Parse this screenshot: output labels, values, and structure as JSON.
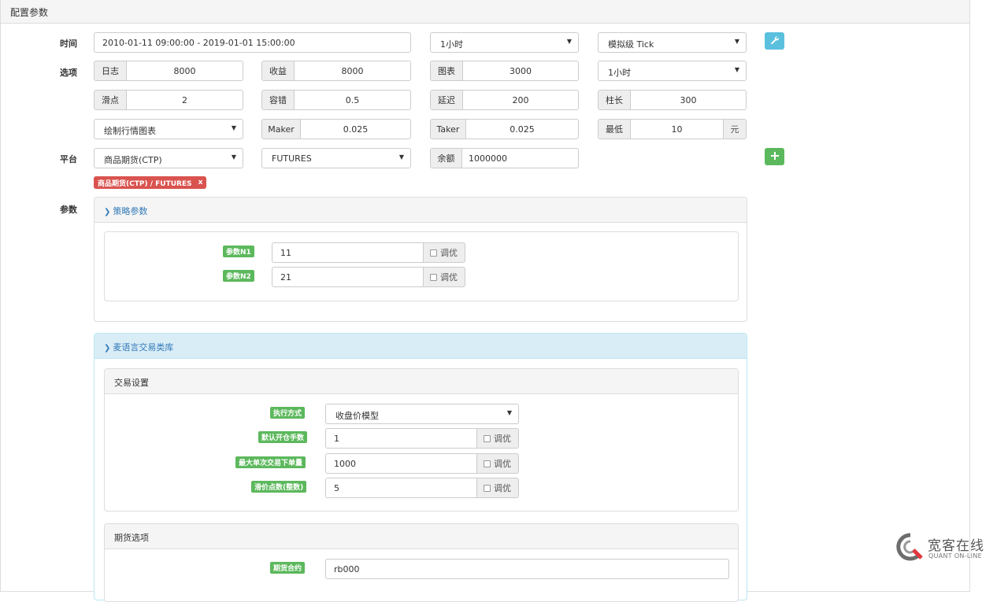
{
  "header": {
    "title": "配置参数"
  },
  "labels": {
    "time": "时间",
    "options": "选项",
    "platform": "平台",
    "params": "参数"
  },
  "time": {
    "range": "2010-01-11 09:00:00 - 2019-01-01 15:00:00",
    "period": "1小时",
    "tick_mode": "模拟级 Tick"
  },
  "options_row1": [
    {
      "label": "日志",
      "value": "8000"
    },
    {
      "label": "收益",
      "value": "8000"
    },
    {
      "label": "图表",
      "value": "3000"
    }
  ],
  "options_row1_select": "1小时",
  "options_row2": [
    {
      "label": "滑点",
      "value": "2"
    },
    {
      "label": "容错",
      "value": "0.5"
    },
    {
      "label": "延迟",
      "value": "200"
    },
    {
      "label": "柱长",
      "value": "300"
    }
  ],
  "options_row3": {
    "chart_select": "绘制行情图表",
    "maker_label": "Maker",
    "maker_value": "0.025",
    "taker_label": "Taker",
    "taker_value": "0.025",
    "min_label": "最低",
    "min_value": "10",
    "min_unit": "元"
  },
  "platform": {
    "exchange": "商品期货(CTP)",
    "type": "FUTURES",
    "balance_label": "余额",
    "balance_value": "1000000",
    "tag": "商品期货(CTP) / FUTURES",
    "tag_close": "x"
  },
  "strategy_panel": {
    "title": "策略参数",
    "params": [
      {
        "label": "参数N1",
        "value": "11",
        "tune": "调优"
      },
      {
        "label": "参数N2",
        "value": "21",
        "tune": "调优"
      }
    ]
  },
  "lib_panel": {
    "title": "麦语言交易类库",
    "trade_settings": {
      "title": "交易设置",
      "exec_label": "执行方式",
      "exec_value": "收盘价模型",
      "rows": [
        {
          "label": "默认开仓手数",
          "value": "1",
          "tune": "调优"
        },
        {
          "label": "最大单次交易下单量",
          "value": "1000",
          "tune": "调优"
        },
        {
          "label": "滑价点数(整数)",
          "value": "5",
          "tune": "调优"
        }
      ]
    },
    "futures_options": {
      "title": "期货选项",
      "contract_label": "期货合约",
      "contract_value": "rb000"
    }
  },
  "watermark": {
    "cn": "宽客在线",
    "en": "QUANT ON-LINE"
  },
  "colors": {
    "accent_blue": "#5bc0de",
    "success_green": "#5cb85c",
    "danger_red": "#d9534f",
    "link_blue": "#337ab7"
  }
}
